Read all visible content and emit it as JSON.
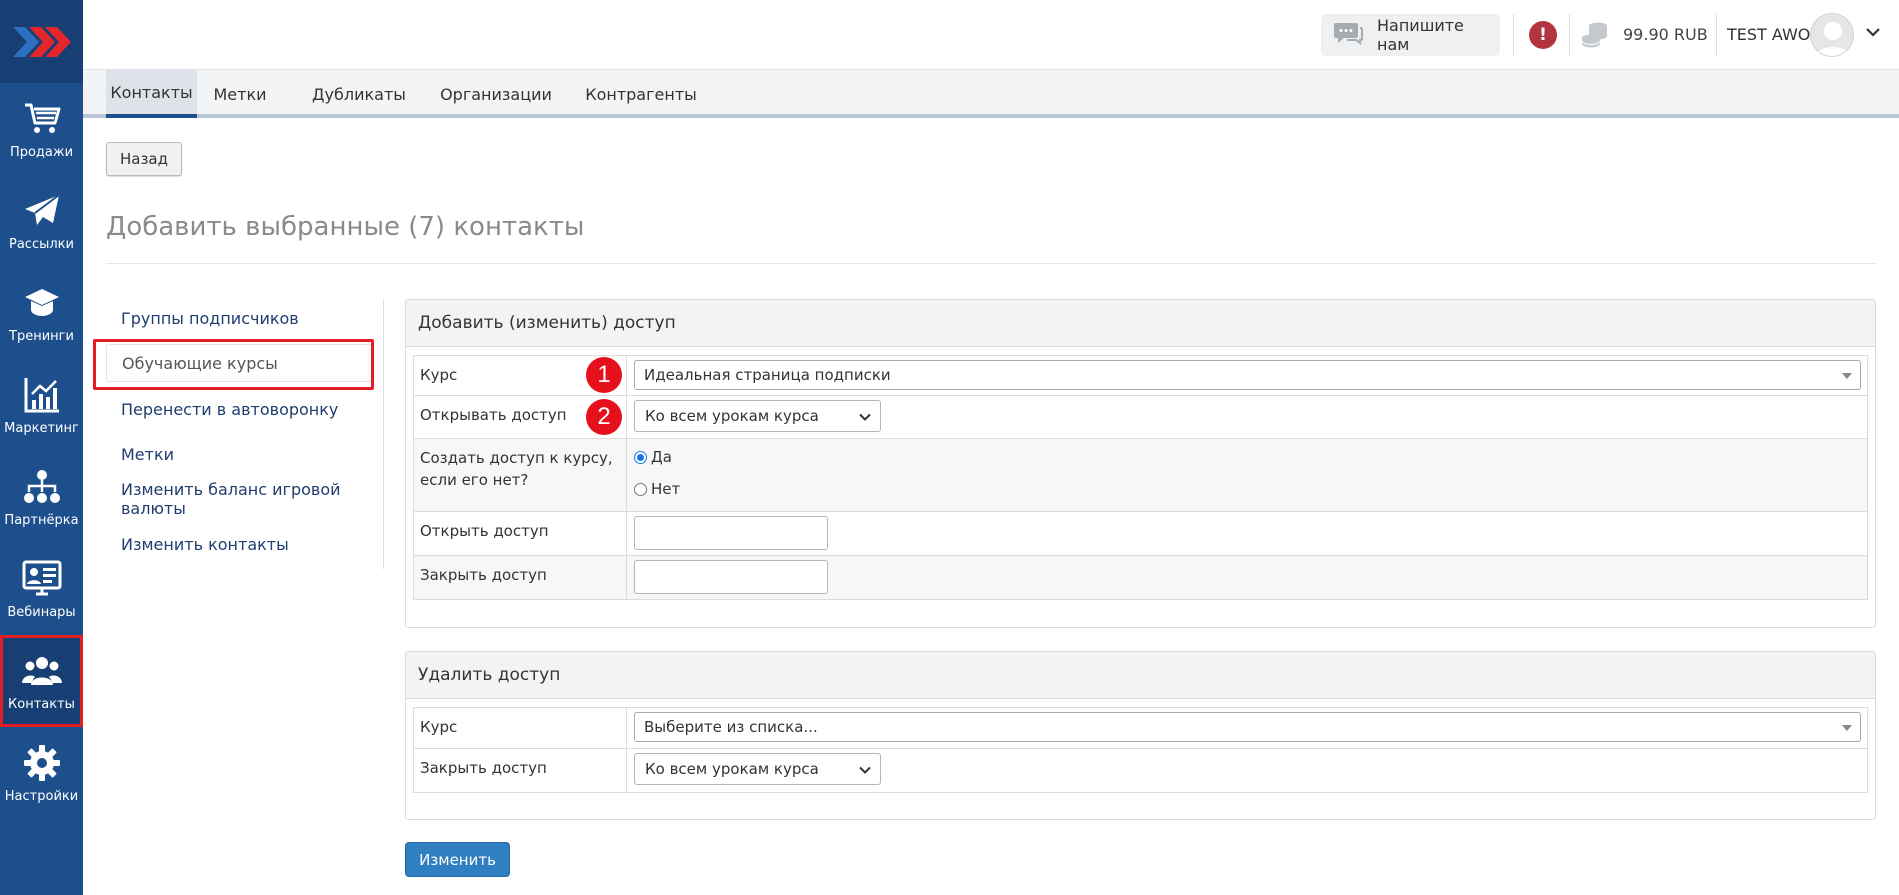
{
  "sidebar": {
    "items": [
      {
        "label": "Продажи",
        "icon": "cart-icon"
      },
      {
        "label": "Рассылки",
        "icon": "paper-plane-icon"
      },
      {
        "label": "Тренинги",
        "icon": "graduation-cap-icon"
      },
      {
        "label": "Маркетинг",
        "icon": "chart-icon"
      },
      {
        "label": "Партнёрка",
        "icon": "network-icon"
      },
      {
        "label": "Вебинары",
        "icon": "webinar-icon"
      },
      {
        "label": "Контакты",
        "icon": "users-icon"
      },
      {
        "label": "Настройки",
        "icon": "gear-icon"
      }
    ],
    "active": "Контакты"
  },
  "header": {
    "chat_label": "Напишите нам",
    "alert_symbol": "!",
    "balance": "99.90 RUB",
    "user_name": "TEST AWO"
  },
  "tabs": [
    "Контакты",
    "Метки",
    "Дубликаты",
    "Организации",
    "Контрагенты"
  ],
  "back_label": "Назад",
  "page_title": "Добавить выбранные (7) контакты",
  "left_menu": [
    "Группы подписчиков",
    "Обучающие курсы",
    "Перенести в автоворонку",
    "Метки",
    "Изменить баланс игровой валюты",
    "Изменить контакты"
  ],
  "add_panel": {
    "title": "Добавить (изменить) доступ",
    "course_label": "Курс",
    "course_value": "Идеальная страница подписки",
    "open_mode_label": "Открывать доступ",
    "open_mode_value": "Ко всем урокам курса",
    "create_label_1": "Создать доступ к курсу,",
    "create_label_2": "если его нет?",
    "radio_yes": "Да",
    "radio_no": "Нет",
    "open_date_label": "Открыть доступ",
    "close_date_label": "Закрыть доступ",
    "badge_1": "1",
    "badge_2": "2"
  },
  "remove_panel": {
    "title": "Удалить доступ",
    "course_label": "Курс",
    "course_placeholder": "Выберите из списка...",
    "close_label": "Закрыть доступ",
    "close_value": "Ко всем урокам курса"
  },
  "submit_label": "Изменить",
  "colors": {
    "sidebar": "#1e4f8d",
    "accent_red": "#e11e24",
    "primary_button": "#2f7fc1"
  }
}
